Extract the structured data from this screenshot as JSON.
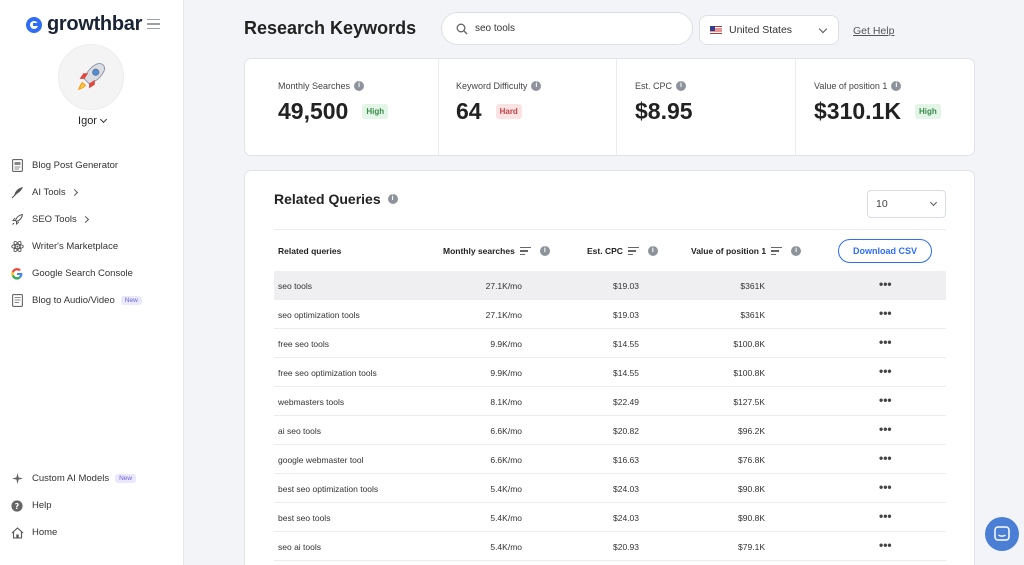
{
  "sidebar": {
    "brand": "growthbar",
    "user": "Igor",
    "nav": [
      {
        "label": "Blog Post Generator",
        "icon": "document-icon"
      },
      {
        "label": "AI Tools",
        "icon": "feather-icon",
        "arrow": true
      },
      {
        "label": "SEO Tools",
        "icon": "rocket-icon",
        "arrow": true
      },
      {
        "label": "Writer's Marketplace",
        "icon": "atom-icon"
      },
      {
        "label": "Google Search Console",
        "icon": "google-icon"
      },
      {
        "label": "Blog to Audio/Video",
        "icon": "file-icon",
        "badge": "New"
      }
    ],
    "bottom": [
      {
        "label": "Custom AI Models",
        "icon": "sparkle-icon",
        "badge": "New"
      },
      {
        "label": "Help",
        "icon": "question-icon"
      },
      {
        "label": "Home",
        "icon": "home-icon"
      }
    ]
  },
  "header": {
    "title": "Research Keywords",
    "search_value": "seo tools",
    "country": "United States",
    "help": "Get Help"
  },
  "metrics": [
    {
      "label": "Monthly Searches",
      "value": "49,500",
      "tag": "High",
      "tag_color": "#3b8b4c"
    },
    {
      "label": "Keyword Difficulty",
      "value": "64",
      "tag": "Hard",
      "tag_color": "#c24444"
    },
    {
      "label": "Est. CPC",
      "value": "$8.95"
    },
    {
      "label": "Value of position 1",
      "value": "$310.1K",
      "tag": "High",
      "tag_color": "#3b8b4c"
    }
  ],
  "related": {
    "title": "Related Queries",
    "per_page": "10",
    "columns": [
      "Related queries",
      "Monthly searches",
      "Est. CPC",
      "Value of position 1"
    ],
    "download_label": "Download CSV",
    "rows": [
      {
        "query": "seo tools",
        "monthly": "27.1K/mo",
        "cpc": "$19.03",
        "value": "$361K"
      },
      {
        "query": "seo optimization tools",
        "monthly": "27.1K/mo",
        "cpc": "$19.03",
        "value": "$361K"
      },
      {
        "query": "free seo tools",
        "monthly": "9.9K/mo",
        "cpc": "$14.55",
        "value": "$100.8K"
      },
      {
        "query": "free seo optimization tools",
        "monthly": "9.9K/mo",
        "cpc": "$14.55",
        "value": "$100.8K"
      },
      {
        "query": "webmasters tools",
        "monthly": "8.1K/mo",
        "cpc": "$22.49",
        "value": "$127.5K"
      },
      {
        "query": "ai seo tools",
        "monthly": "6.6K/mo",
        "cpc": "$20.82",
        "value": "$96.2K"
      },
      {
        "query": "google webmaster tool",
        "monthly": "6.6K/mo",
        "cpc": "$16.63",
        "value": "$76.8K"
      },
      {
        "query": "best seo optimization tools",
        "monthly": "5.4K/mo",
        "cpc": "$24.03",
        "value": "$90.8K"
      },
      {
        "query": "best seo tools",
        "monthly": "5.4K/mo",
        "cpc": "$24.03",
        "value": "$90.8K"
      },
      {
        "query": "seo ai tools",
        "monthly": "5.4K/mo",
        "cpc": "$20.93",
        "value": "$79.1K"
      }
    ]
  },
  "colors": {
    "accent": "#2f6df6",
    "tag_green_bg": "#e2f5e6",
    "tag_red_bg": "#fbe3e3"
  }
}
